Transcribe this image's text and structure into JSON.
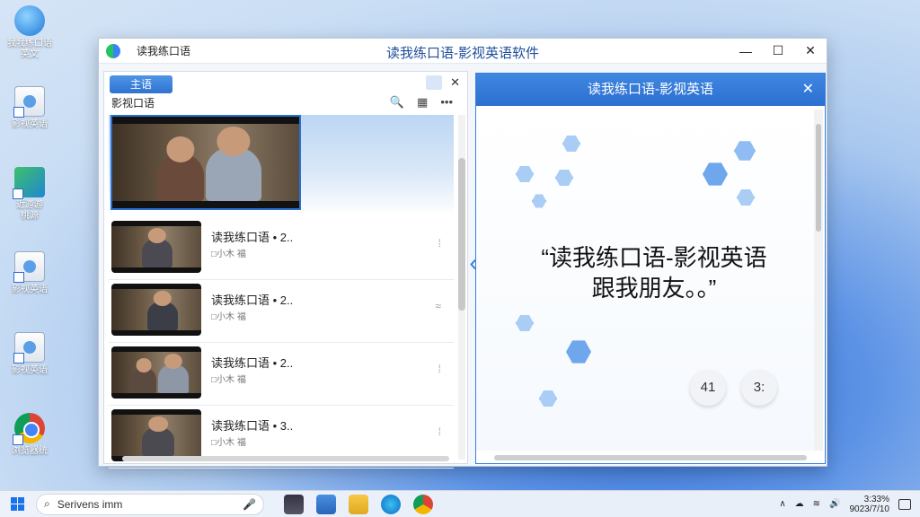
{
  "desktop": {
    "icons": [
      {
        "label": "我我练口语\n英文"
      },
      {
        "label": "影视英语"
      },
      {
        "label": "近游游\n桃源"
      },
      {
        "label": "影视英语"
      },
      {
        "label": "影视英语"
      },
      {
        "label": "浏览器统"
      }
    ]
  },
  "window": {
    "small_title": "读我练口语",
    "title": "读我练口语-影视英语软件",
    "controls": {
      "minimize": "—",
      "maximize": "☐",
      "close": "✕"
    }
  },
  "left": {
    "tab_label": "主语",
    "section_title": "影视口语",
    "close": "✕",
    "tools": {
      "search": "🔍",
      "calendar": "▦",
      "more": "•••"
    },
    "items": [
      {
        "title": "读我练口语 • 2..",
        "meta": "□小木 福",
        "more": "⁞"
      },
      {
        "title": "读我练口语 • 2..",
        "meta": "□小木 福",
        "more": "≈"
      },
      {
        "title": "读我练口语 • 2..",
        "meta": "□小木 福",
        "more": "⁞"
      },
      {
        "title": "读我练口语 • 3..",
        "meta": "□小木 福",
        "more": "⁞"
      }
    ]
  },
  "right": {
    "title": "读我练口语-影视英语",
    "close": "✕",
    "quote": "“读我练口语-影视英语\n跟我朋友。。”",
    "btn_a": "41",
    "btn_b": "3:"
  },
  "taskbar": {
    "search_text": "Serivens imm",
    "mic": "🎤",
    "time": "3:33%",
    "date": "9023/7/10",
    "tray_up": "∧"
  },
  "colors": {
    "accent": "#2f73d0",
    "title_text": "#1f4e9a"
  }
}
